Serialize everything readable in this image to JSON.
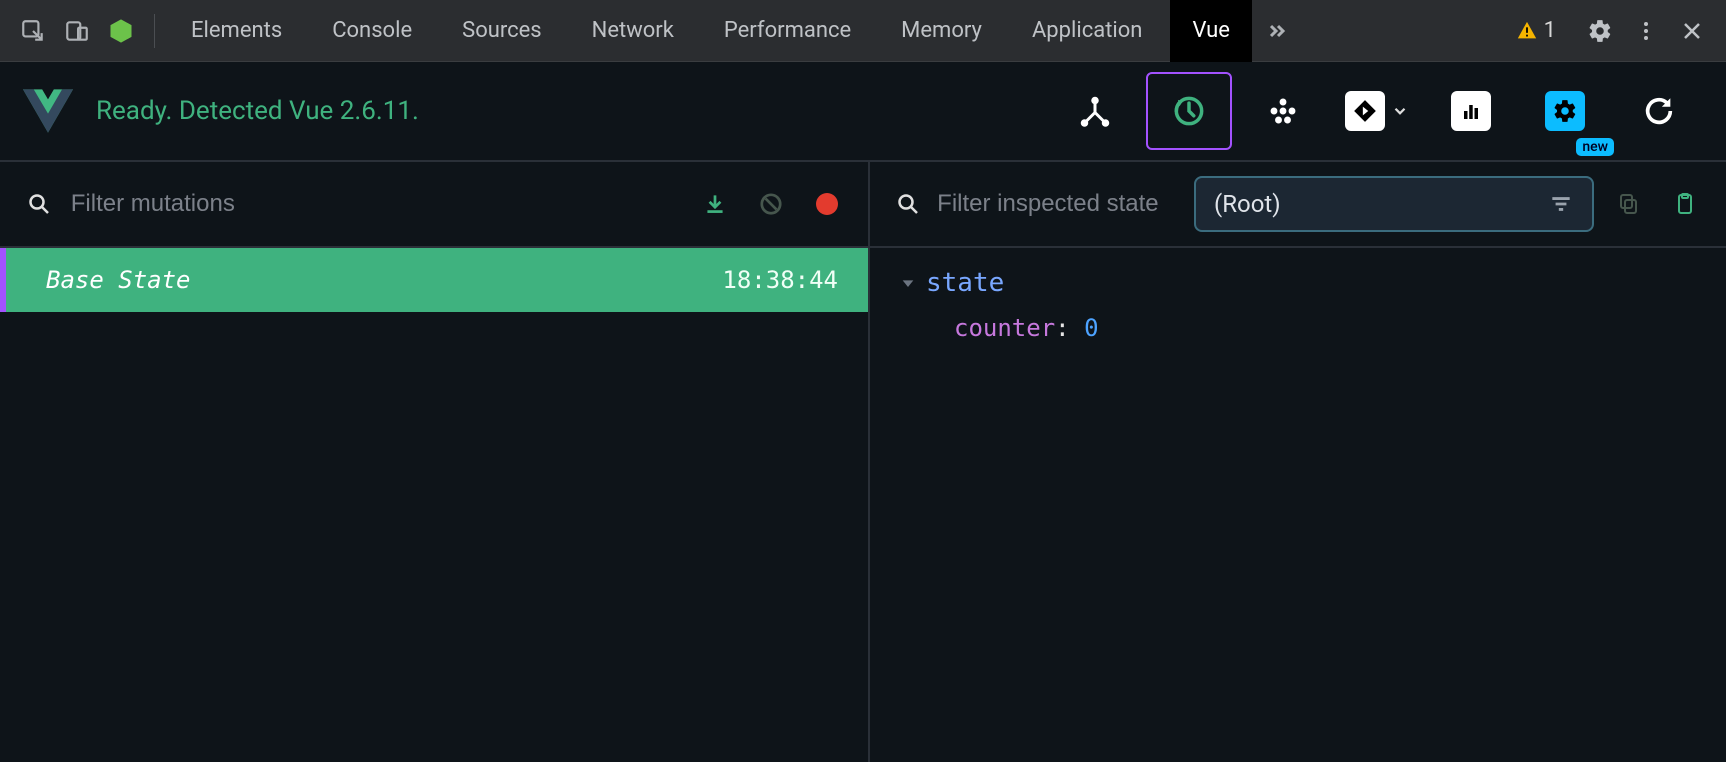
{
  "devtools": {
    "tabs": [
      "Elements",
      "Console",
      "Sources",
      "Network",
      "Performance",
      "Memory",
      "Application",
      "Vue"
    ],
    "active_tab": "Vue",
    "warning_count": "1"
  },
  "vue": {
    "status": "Ready. Detected Vue 2.6.11.",
    "badge_new": "new"
  },
  "left": {
    "filter_placeholder": "Filter mutations",
    "mutations": [
      {
        "label": "Base State",
        "time": "18:38:44"
      }
    ]
  },
  "right": {
    "filter_placeholder": "Filter inspected state",
    "selector_value": "(Root)",
    "state_title": "state",
    "kv": {
      "key": "counter",
      "value": "0"
    }
  }
}
